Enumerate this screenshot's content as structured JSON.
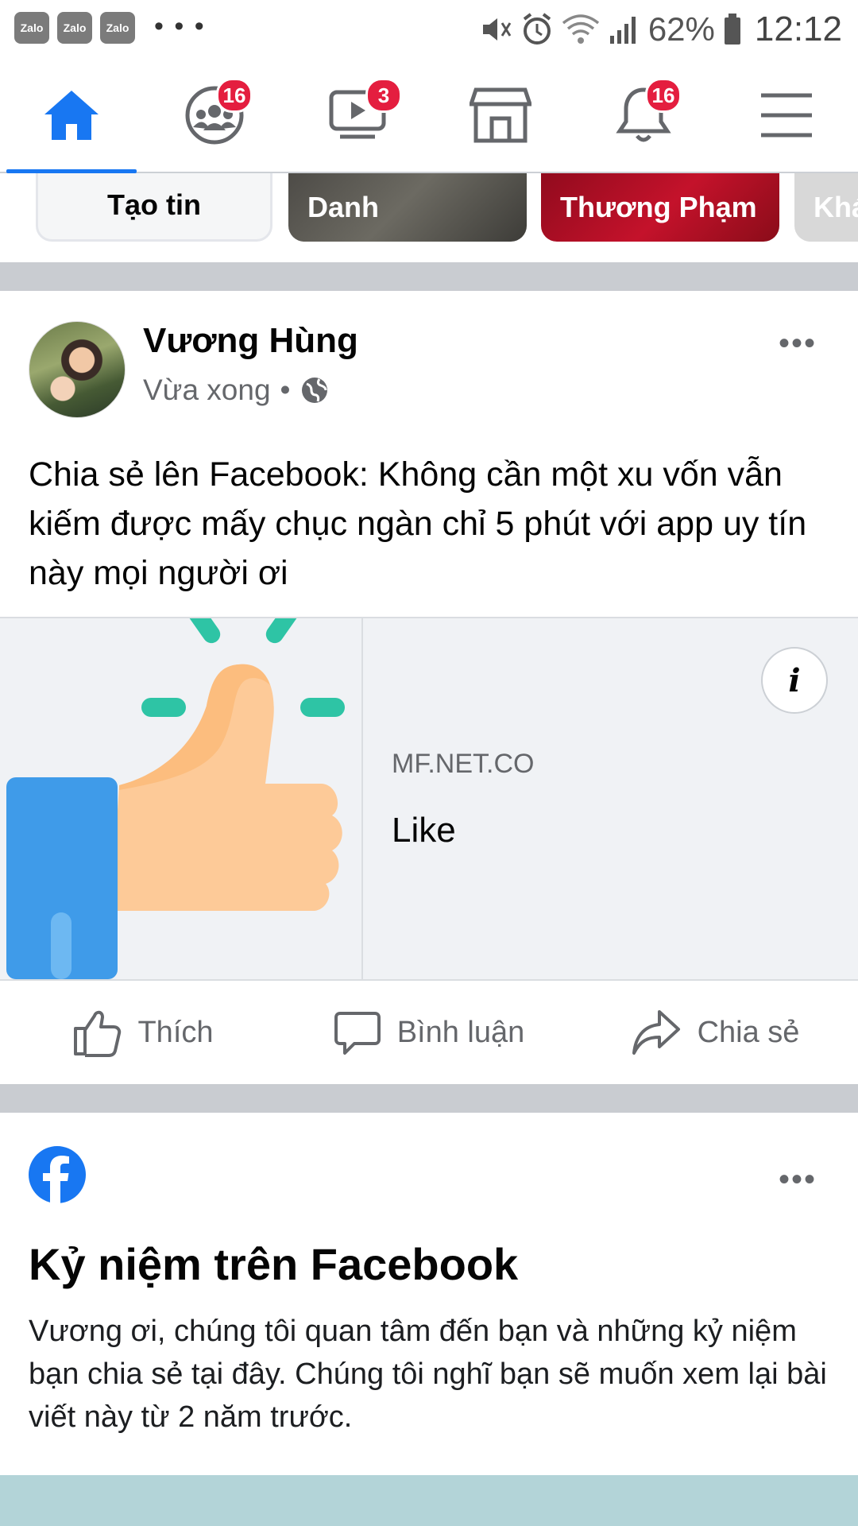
{
  "status_bar": {
    "apps": [
      "Zalo",
      "Zalo",
      "Zalo"
    ],
    "overflow": "• • •",
    "battery_pct": "62%",
    "time": "12:12",
    "icons": [
      "mute-icon",
      "alarm-icon",
      "wifi-icon",
      "signal-icon",
      "battery-icon"
    ]
  },
  "nav": {
    "items": [
      {
        "name": "home",
        "icon": "home-icon",
        "badge": ""
      },
      {
        "name": "groups",
        "icon": "groups-icon",
        "badge": "16"
      },
      {
        "name": "watch",
        "icon": "video-icon",
        "badge": "3"
      },
      {
        "name": "marketplace",
        "icon": "store-icon",
        "badge": ""
      },
      {
        "name": "notifications",
        "icon": "bell-icon",
        "badge": "16"
      },
      {
        "name": "menu",
        "icon": "menu-icon",
        "badge": ""
      }
    ],
    "active_color": "#1877f2",
    "badge_color": "#e41e3f"
  },
  "stories": {
    "create_label": "Tạo tin",
    "items": [
      "Danh",
      "Thương Phạm",
      "Khá"
    ]
  },
  "post": {
    "author": "Vương Hùng",
    "time": "Vừa xong",
    "separator": "•",
    "privacy_icon": "globe-icon",
    "text": "Chia sẻ lên Facebook: Không cần một xu vốn vẫn kiếm được mấy chục ngàn chỉ 5 phút với app uy tín này mọi người ơi",
    "link": {
      "domain": "MF.NET.CO",
      "title": "Like",
      "image_icon": "thumbs-up-illustration",
      "info": "i"
    },
    "actions": {
      "like": "Thích",
      "comment": "Bình luận",
      "share": "Chia sẻ"
    }
  },
  "memories": {
    "logo_icon": "facebook-icon",
    "title": "Kỷ niệm trên Facebook",
    "text": "Vương ơi, chúng tôi quan tâm đến bạn và những kỷ niệm bạn chia sẻ tại đây. Chúng tôi nghĩ bạn sẽ muốn xem lại bài viết này từ 2 năm trước."
  },
  "more_label": "•••"
}
